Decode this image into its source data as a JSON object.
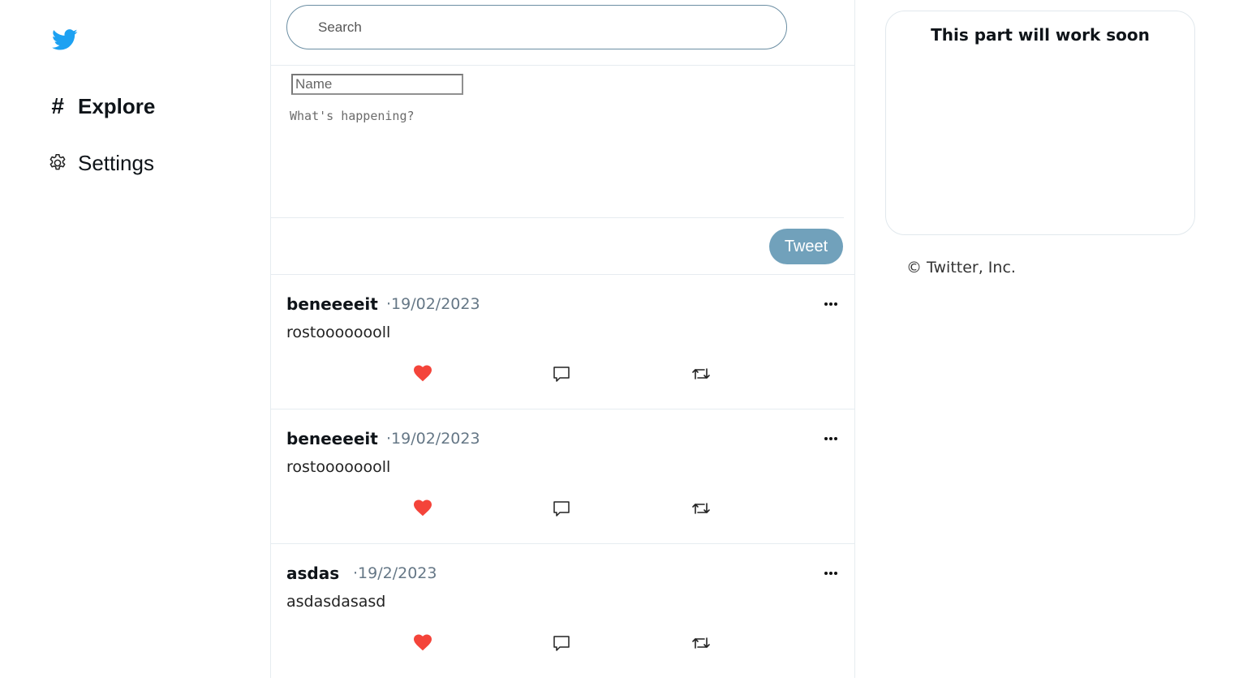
{
  "sidebar": {
    "logo": "twitter-bird-icon",
    "items": [
      {
        "icon": "hash-icon",
        "glyph": "#",
        "label": "Explore"
      },
      {
        "icon": "gear-icon",
        "label": "Settings"
      }
    ]
  },
  "search": {
    "placeholder": "Search"
  },
  "compose": {
    "name_placeholder": "Name",
    "text_placeholder": "What's happening?",
    "tweet_label": "Tweet"
  },
  "tweets": [
    {
      "user": "beneeeeit",
      "date": "·19/02/2023",
      "text": "rostoooooooll"
    },
    {
      "user": "beneeeeit",
      "date": "·19/02/2023",
      "text": "rostoooooooll"
    },
    {
      "user": "asdas",
      "date": "·19/2/2023",
      "text": "asdasdasasd"
    }
  ],
  "right": {
    "card_title": "This part will work soon",
    "copyright": "© Twitter, Inc."
  },
  "colors": {
    "brand": "#1da1f2",
    "like": "#f4443a",
    "tweet_button": "#71a1bb"
  }
}
